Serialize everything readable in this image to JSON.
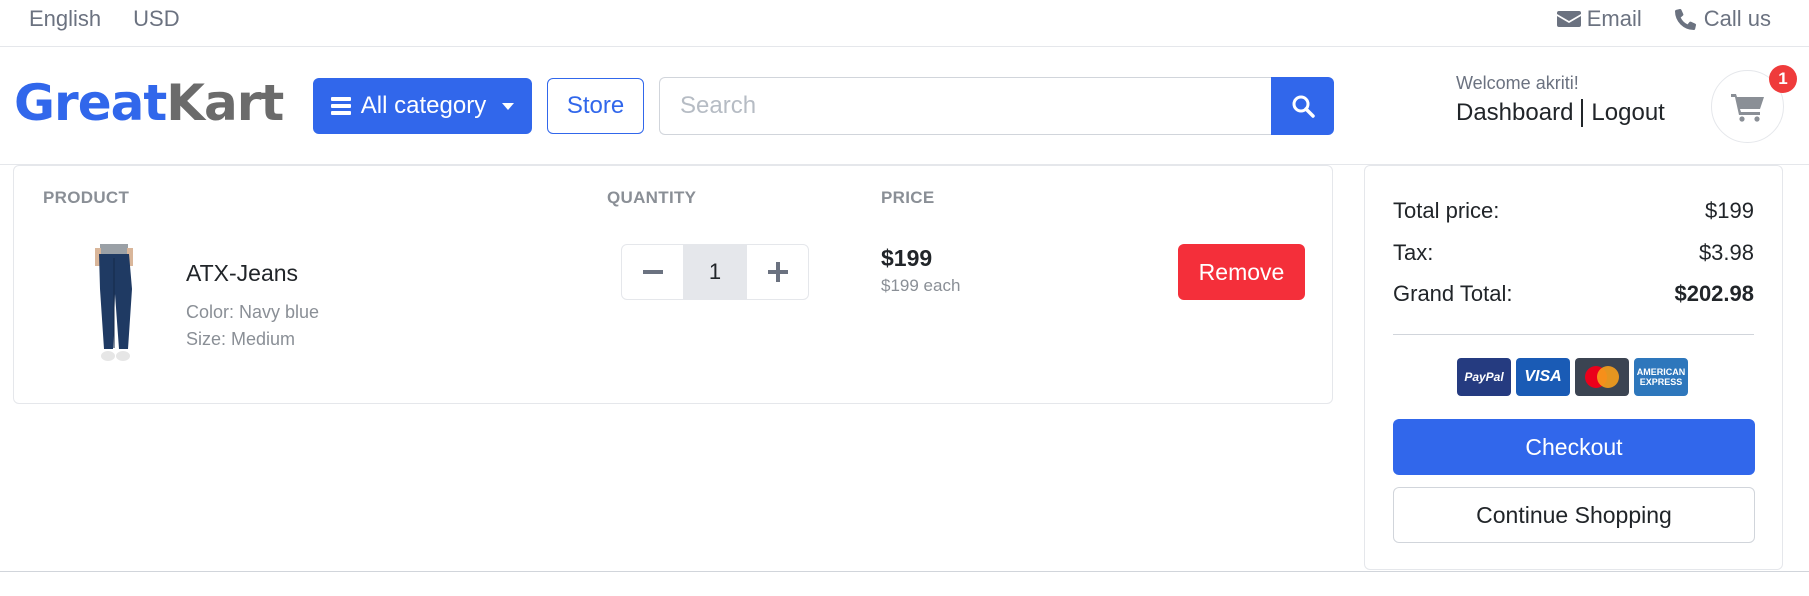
{
  "topbar": {
    "language": "English",
    "currency": "USD",
    "email_label": "Email",
    "call_label": "Call us"
  },
  "header": {
    "logo_part1": "Great",
    "logo_part2": "Kart",
    "category_button": "All category",
    "store_button": "Store",
    "search_placeholder": "Search",
    "welcome_text": "Welcome akriti!",
    "dashboard_link": "Dashboard",
    "logout_link": "Logout",
    "cart_count": "1"
  },
  "cart_table": {
    "headers": [
      "PRODUCT",
      "QUANTITY",
      "PRICE"
    ],
    "items": [
      {
        "name": "ATX-Jeans",
        "color": "Color: Navy blue",
        "size": "Size: Medium",
        "quantity": "1",
        "price": "$199",
        "price_each": "$199 each",
        "remove_label": "Remove"
      }
    ]
  },
  "summary": {
    "total_price_label": "Total price:",
    "total_price_value": "$199",
    "tax_label": "Tax:",
    "tax_value": "$3.98",
    "grand_total_label": "Grand Total:",
    "grand_total_value": "$202.98",
    "payment_methods": [
      "PayPal",
      "VISA",
      "Mastercard",
      "AMERICAN EXPRESS"
    ],
    "checkout_label": "Checkout",
    "continue_label": "Continue Shopping"
  },
  "colors": {
    "primary": "#3167eb",
    "danger": "#f42f3a",
    "muted": "#8a8f96",
    "badge": "#ef3b3b"
  }
}
